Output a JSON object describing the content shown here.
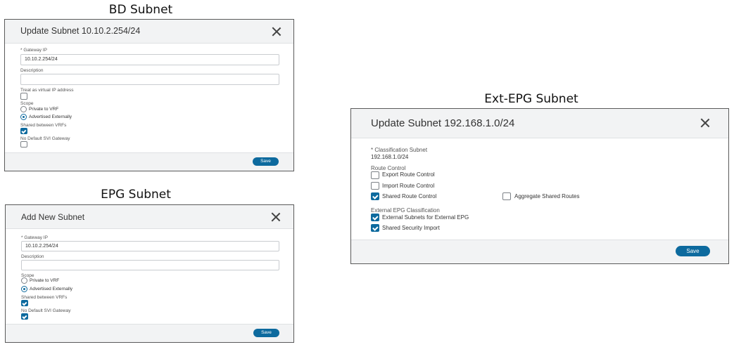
{
  "bd": {
    "caption": "BD Subnet",
    "title": "Update Subnet 10.10.2.254/24",
    "gateway_label": "* Gateway IP",
    "gateway_value": "10.10.2.254/24",
    "description_label": "Description",
    "description_value": "",
    "virtual_ip_label": "Treat as virtual IP address",
    "virtual_ip_checked": false,
    "scope_label": "Scope",
    "scope_private": "Private to VRF",
    "scope_advertised": "Advertised Externally",
    "scope_selected": "Advertised Externally",
    "shared_label": "Shared between VRFs",
    "shared_checked": true,
    "no_default_label": "No Default SVI Gateway",
    "no_default_checked": false,
    "save_label": "Save"
  },
  "epg": {
    "caption": "EPG Subnet",
    "title": "Add New Subnet",
    "gateway_label": "* Gateway IP",
    "gateway_value": "10.10.2.254/24",
    "description_label": "Description",
    "description_value": "",
    "scope_label": "Scope",
    "scope_private": "Private to VRF",
    "scope_advertised": "Advertised Externally",
    "scope_selected": "Advertised Externally",
    "shared_label": "Shared between VRFs",
    "shared_checked": true,
    "no_default_label": "No Default SVI Gateway",
    "no_default_checked": true,
    "save_label": "Save"
  },
  "ext": {
    "caption": "Ext-EPG Subnet",
    "title": "Update Subnet 192.168.1.0/24",
    "classification_label": "* Classification Subnet",
    "classification_value": "192.168.1.0/24",
    "route_control_label": "Route Control",
    "export_label": "Export Route Control",
    "export_checked": false,
    "import_label": "Import Route Control",
    "import_checked": false,
    "shared_route_label": "Shared Route Control",
    "shared_route_checked": true,
    "aggregate_label": "Aggregate Shared Routes",
    "aggregate_checked": false,
    "ext_class_label": "External EPG Classification",
    "ext_subnets_label": "External Subnets for External EPG",
    "ext_subnets_checked": true,
    "security_label": "Shared Security Import",
    "security_checked": true,
    "save_label": "Save"
  },
  "colors": {
    "accent": "#0d6a9e",
    "header_bg": "#f2f3f4",
    "border": "#5a5a5a"
  },
  "icons": {
    "close": "close-icon"
  }
}
